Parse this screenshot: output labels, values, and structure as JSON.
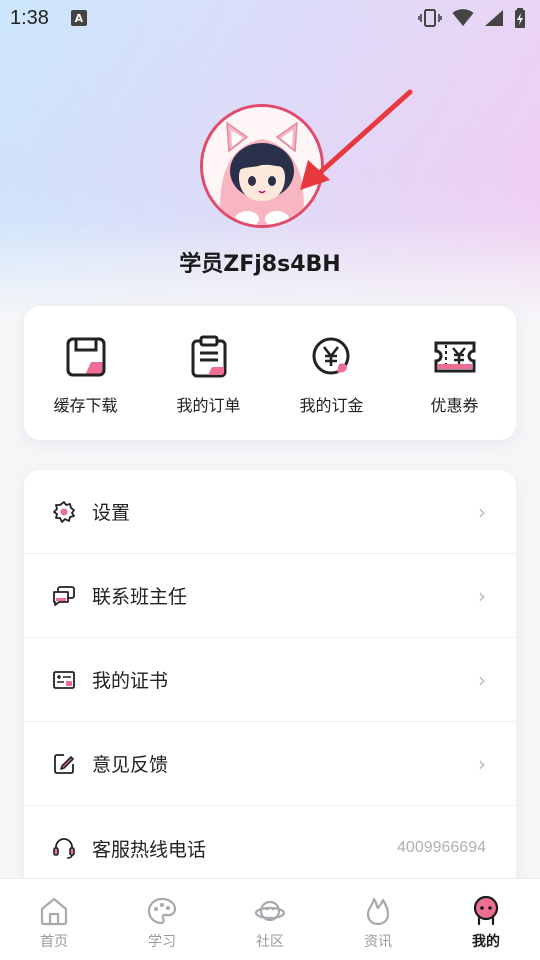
{
  "status_bar": {
    "time": "1:38",
    "notification_icon": "A"
  },
  "profile": {
    "username": "学员ZFj8s4BH"
  },
  "quick_actions": [
    {
      "label": "缓存下载",
      "icon": "save-icon"
    },
    {
      "label": "我的订单",
      "icon": "clipboard-icon"
    },
    {
      "label": "我的订金",
      "icon": "yen-coin-icon"
    },
    {
      "label": "优惠券",
      "icon": "coupon-icon"
    }
  ],
  "menu": [
    {
      "label": "设置",
      "icon": "settings-icon"
    },
    {
      "label": "联系班主任",
      "icon": "chat-icon"
    },
    {
      "label": "我的证书",
      "icon": "certificate-icon"
    },
    {
      "label": "意见反馈",
      "icon": "edit-icon"
    },
    {
      "label": "客服热线电话",
      "icon": "headset-icon",
      "value": "4009966694"
    }
  ],
  "bottom_nav": [
    {
      "label": "首页",
      "icon": "home-icon"
    },
    {
      "label": "学习",
      "icon": "palette-icon"
    },
    {
      "label": "社区",
      "icon": "planet-icon"
    },
    {
      "label": "资讯",
      "icon": "flame-icon"
    },
    {
      "label": "我的",
      "icon": "profile-icon",
      "active": true
    }
  ],
  "colors": {
    "accent": "#e14b6b",
    "pink": "#ef6f93",
    "text": "#222222"
  }
}
